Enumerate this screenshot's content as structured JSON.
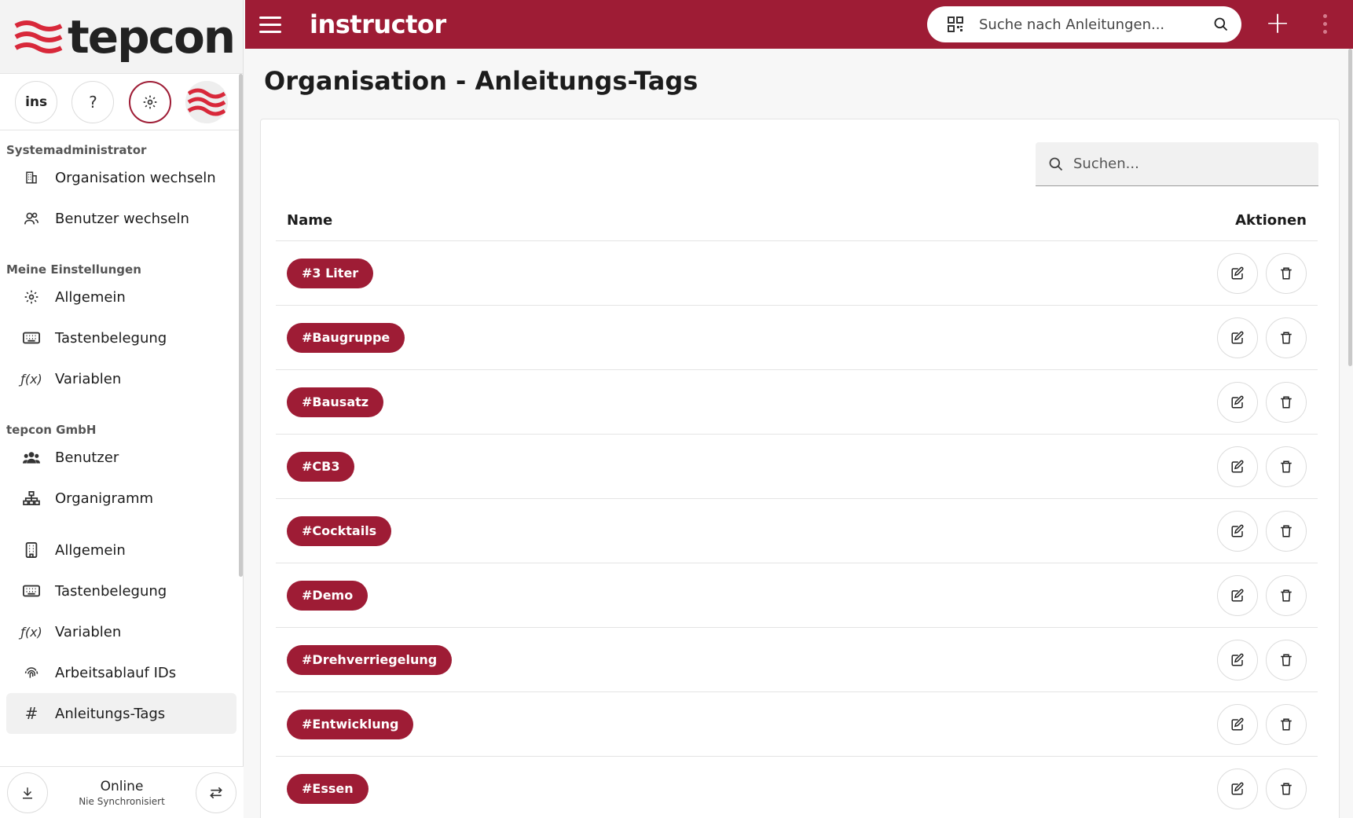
{
  "brand": {
    "logo_text": "tepcon",
    "app_name": "instructor",
    "accent_color": "#9e1c35"
  },
  "sidebar": {
    "icon_row": {
      "ins_label": "ins",
      "help_label": "?"
    },
    "sections": [
      {
        "title": "Systemadministrator",
        "items": [
          {
            "label": "Organisation wechseln",
            "icon": "building-icon"
          },
          {
            "label": "Benutzer wechseln",
            "icon": "users-icon"
          }
        ]
      },
      {
        "title": "Meine Einstellungen",
        "items": [
          {
            "label": "Allgemein",
            "icon": "gear-icon"
          },
          {
            "label": "Tastenbelegung",
            "icon": "keyboard-icon"
          },
          {
            "label": "Variablen",
            "icon": "function-icon"
          }
        ]
      },
      {
        "title": "tepcon GmbH",
        "items": [
          {
            "label": "Benutzer",
            "icon": "group-icon"
          },
          {
            "label": "Organigramm",
            "icon": "org-chart-icon"
          },
          {
            "label": "Allgemein",
            "icon": "office-building-icon"
          },
          {
            "label": "Tastenbelegung",
            "icon": "keyboard-icon"
          },
          {
            "label": "Variablen",
            "icon": "function-icon"
          },
          {
            "label": "Arbeitsablauf IDs",
            "icon": "fingerprint-icon"
          },
          {
            "label": "Anleitungs-Tags",
            "icon": "hash-icon",
            "active": true
          }
        ]
      }
    ],
    "footer": {
      "status": "Online",
      "sync": "Nie Synchronisiert"
    }
  },
  "topbar": {
    "search_placeholder": "Suche nach Anleitungen..."
  },
  "main": {
    "title": "Organisation - Anleitungs-Tags",
    "search_placeholder": "Suchen...",
    "columns": {
      "name": "Name",
      "actions": "Aktionen"
    },
    "rows": [
      "#3 Liter",
      "#Baugruppe",
      "#Bausatz",
      "#CB3",
      "#Cocktails",
      "#Demo",
      "#Drehverriegelung",
      "#Entwicklung",
      "#Essen"
    ]
  }
}
